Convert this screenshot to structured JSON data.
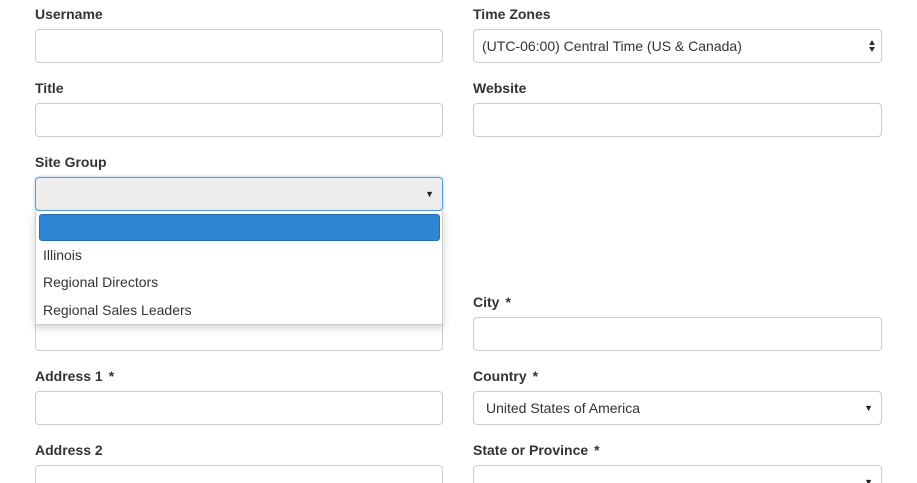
{
  "fields": {
    "username": {
      "label": "Username",
      "value": ""
    },
    "time_zones": {
      "label": "Time Zones",
      "value": "(UTC-06:00) Central Time (US & Canada)"
    },
    "title": {
      "label": "Title",
      "value": ""
    },
    "website": {
      "label": "Website",
      "value": ""
    },
    "site_group": {
      "label": "Site Group",
      "value": "",
      "options": [
        "",
        "Illinois",
        "Regional Directors",
        "Regional Sales Leaders"
      ],
      "highlighted_index": 0
    },
    "city": {
      "label": "City",
      "required_marker": "*",
      "value": ""
    },
    "address1": {
      "label": "Address 1",
      "required_marker": "*",
      "value": ""
    },
    "country": {
      "label": "Country",
      "required_marker": "*",
      "value": "United States of America"
    },
    "address2": {
      "label": "Address 2",
      "value": ""
    },
    "state": {
      "label": "State or Province",
      "required_marker": "*",
      "value": ""
    }
  },
  "colors": {
    "highlight": "#2f86d2",
    "focus_border": "#5b9dd9",
    "input_border": "#cccccc"
  },
  "icons": {
    "select_caret": "caret-down-icon",
    "native_select_arrows": "up-down-arrows-icon"
  }
}
